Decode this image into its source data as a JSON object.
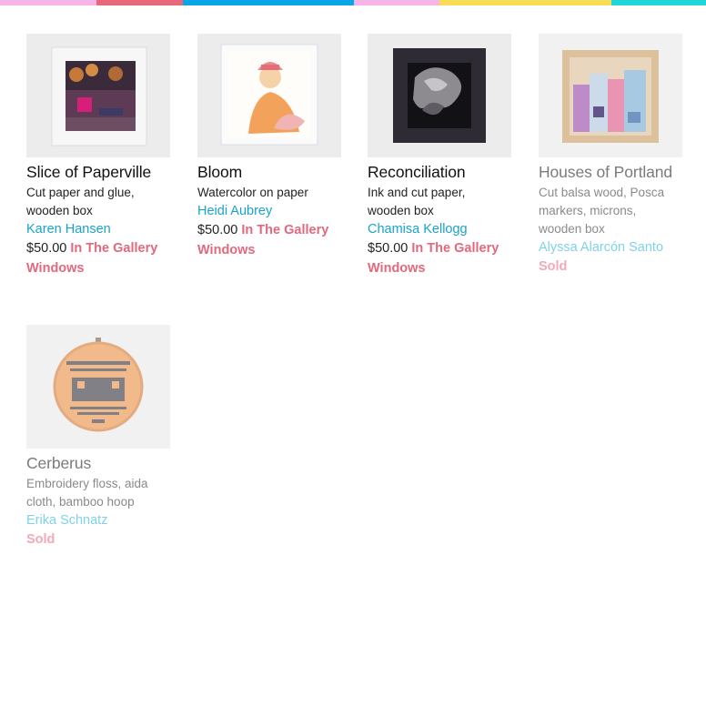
{
  "stripe_colors": [
    "#f7b4e6",
    "#e9677a",
    "#0aa5e6",
    "#f7b4e6",
    "#f8dc55",
    "#20d6d6"
  ],
  "products": [
    {
      "title": "Slice of Paperville",
      "medium": "Cut paper and glue, wooden box",
      "artist": "Karen Hansen",
      "price": "$50.00",
      "location": "In The Gallery Windows",
      "sold": ""
    },
    {
      "title": "Bloom",
      "medium": "Watercolor on paper",
      "artist": "Heidi Aubrey",
      "price": "$50.00",
      "location": "In The Gallery Windows",
      "sold": ""
    },
    {
      "title": "Reconciliation",
      "medium": "Ink and cut paper, wooden box",
      "artist": "Chamisa Kellogg",
      "price": "$50.00",
      "location": "In The Gallery Windows",
      "sold": ""
    },
    {
      "title": "Houses of Portland",
      "medium": "Cut balsa wood, Posca markers, microns, wooden box",
      "artist": "Alyssa Alarcón Santo",
      "price": "",
      "location": "",
      "sold": "Sold"
    },
    {
      "title": "Cerberus",
      "medium": "Embroidery floss, aida cloth, bamboo hoop",
      "artist": "Erika Schnatz",
      "price": "",
      "location": "",
      "sold": "Sold"
    }
  ]
}
